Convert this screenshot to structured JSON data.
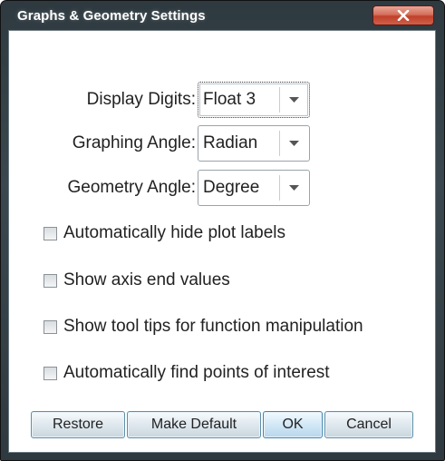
{
  "window": {
    "title": "Graphs & Geometry Settings",
    "close_icon": "close-x-icon"
  },
  "settings": {
    "display_digits": {
      "label": "Display Digits:",
      "value": "Float 3"
    },
    "graphing_angle": {
      "label": "Graphing Angle:",
      "value": "Radian"
    },
    "geometry_angle": {
      "label": "Geometry Angle:",
      "value": "Degree"
    }
  },
  "options": [
    {
      "label": "Automatically hide plot labels",
      "checked": false
    },
    {
      "label": "Show axis end values",
      "checked": false
    },
    {
      "label": "Show tool tips for function manipulation",
      "checked": false
    },
    {
      "label": "Automatically find points of interest",
      "checked": false
    }
  ],
  "buttons": {
    "restore": "Restore",
    "make_default": "Make Default",
    "ok": "OK",
    "cancel": "Cancel"
  },
  "colors": {
    "titlebar": "#35424a",
    "close_button": "#c9503a",
    "button_border": "#5f8fa8"
  }
}
